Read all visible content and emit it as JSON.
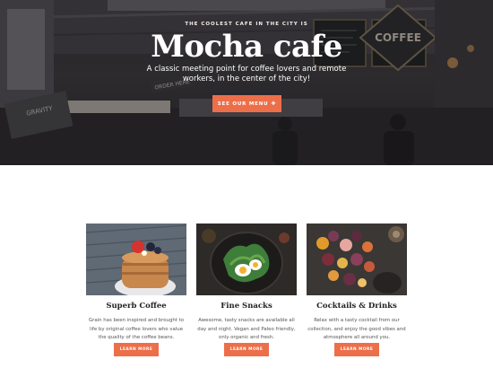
{
  "hero": {
    "eyebrow": "THE COOLEST CAFE IN THE CITY IS",
    "title": "Mocha cafe",
    "subtitle": "A classic meeting point for coffee lovers and remote workers, in the center of the city!",
    "cta_label": "SEE OUR MENU",
    "cta_icon": "plus-icon",
    "sign_coffee": "COFFEE",
    "sign_order": "ORDER HERE",
    "sign_gravity": "GRAVITY"
  },
  "colors": {
    "accent": "#ec6f4a",
    "hero_dark": "#2f2f33"
  },
  "features": [
    {
      "title": "Superb Coffee",
      "text": "Grain has been inspired and brought to life by original coffee lovers who value the quality of the coffee beans.",
      "button": "LEARN MORE"
    },
    {
      "title": "Fine Snacks",
      "text": "Awesome, tasty snacks are available all day and night. Vegan and Paleo friendly, only organic and fresh.",
      "button": "LEARN MORE"
    },
    {
      "title": "Cocktails & Drinks",
      "text": "Relax with a tasty cocktail from our collection, and enjoy the good vibes and atmosphere all around you.",
      "button": "LEARN MORE"
    }
  ]
}
